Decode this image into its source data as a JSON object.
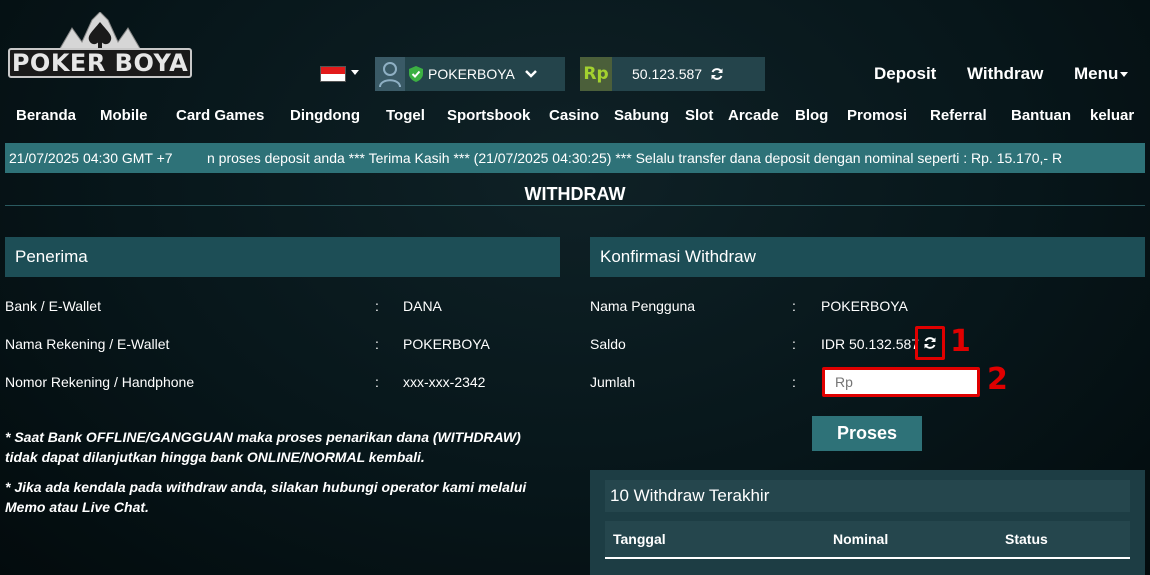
{
  "logo": {
    "text": "POKER BOYA"
  },
  "topbar": {
    "username": "POKERBOYA",
    "balance": "50.123.587",
    "currency_icon": "Rp",
    "links": {
      "deposit": "Deposit",
      "withdraw": "Withdraw",
      "menu": "Menu"
    }
  },
  "nav": {
    "items": [
      "Beranda",
      "Mobile",
      "Card Games",
      "Dingdong",
      "Togel",
      "Sportsbook",
      "Casino",
      "Sabung",
      "Slot",
      "Arcade",
      "Blog",
      "Promosi",
      "Referral",
      "Bantuan",
      "keluar"
    ]
  },
  "marquee": {
    "time": "21/07/2025 04:30 GMT +7",
    "message": "n proses deposit anda *** Terima Kasih *** (21/07/2025 04:30:25) *** Selalu transfer dana deposit dengan nominal seperti : Rp. 15.170,- R"
  },
  "page_title": "WITHDRAW",
  "penerima": {
    "title": "Penerima",
    "rows": [
      {
        "label": "Bank / E-Wallet",
        "colon": ":",
        "value": "DANA"
      },
      {
        "label": "Nama Rekening / E-Wallet",
        "colon": ":",
        "value": "POKERBOYA"
      },
      {
        "label": "Nomor Rekening / Handphone",
        "colon": ":",
        "value": "xxx-xxx-2342"
      }
    ],
    "notes": [
      "* Saat Bank OFFLINE/GANGGUAN maka proses penarikan dana (WITHDRAW) tidak dapat dilanjutkan hingga bank ONLINE/NORMAL kembali.",
      "* Jika ada kendala pada withdraw anda, silakan hubungi operator kami melalui Memo atau Live Chat."
    ]
  },
  "konfirmasi": {
    "title": "Konfirmasi Withdraw",
    "rows": [
      {
        "label": "Nama Pengguna",
        "colon": ":",
        "value": "POKERBOYA"
      },
      {
        "label": "Saldo",
        "colon": ":",
        "value": "IDR 50.132.587"
      },
      {
        "label": "Jumlah",
        "colon": ":"
      }
    ],
    "amount_placeholder": "Rp",
    "submit_label": "Proses",
    "markers": [
      "1",
      "2"
    ]
  },
  "history": {
    "title": "10 Withdraw Terakhir",
    "columns": [
      "Tanggal",
      "Nominal",
      "Status"
    ]
  },
  "colors": {
    "accent": "#2e7278",
    "panel_header": "#1d4e56",
    "highlight_red": "#e00000",
    "rp_green": "#a3d12f"
  }
}
